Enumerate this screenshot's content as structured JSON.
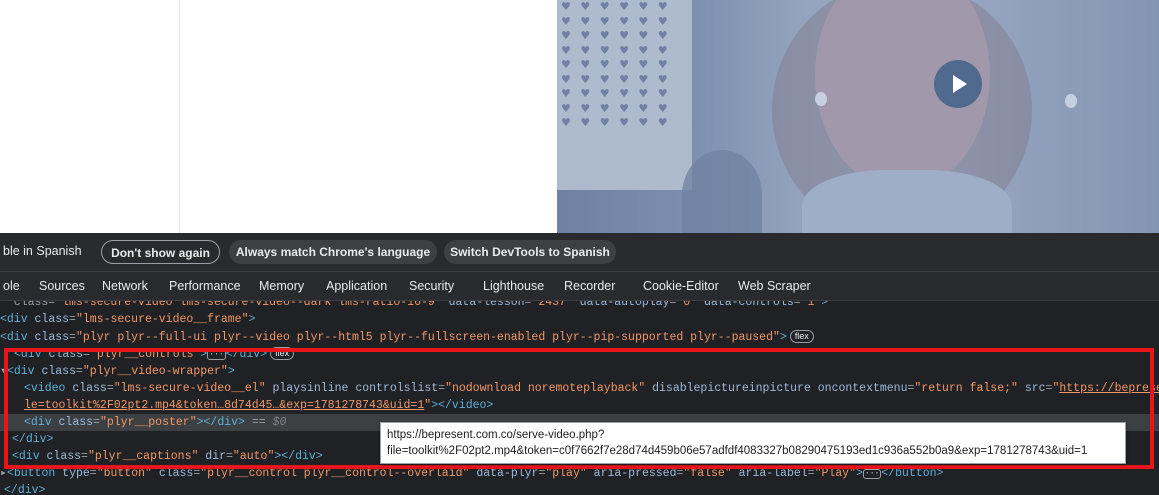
{
  "infobar": {
    "text": "ble in Spanish",
    "dont_show_again": "Don't show again",
    "always_match": "Always match Chrome's language",
    "switch_spanish": "Switch DevTools to Spanish"
  },
  "tabs": [
    "ole",
    "Sources",
    "Network",
    "Performance",
    "Memory",
    "Application",
    "Security",
    "Lighthouse",
    "Recorder",
    "Cookie-Editor",
    "Web Scraper"
  ],
  "code": {
    "l1": {
      "pre": "\" class=\"",
      "val1": "lms-secure-video lms-secure-video--dark lms-ratio-16-9",
      "a2": "data-lesson",
      "val2": "2437",
      "a3": "data-autoplay",
      "val3": "0",
      "a4": "data-controls",
      "val4": "1"
    },
    "l2": {
      "tag": "div",
      "attr": "class",
      "val": "lms-secure-video__frame"
    },
    "l3": {
      "tag": "div",
      "attr": "class",
      "val": "plyr plyr--full-ui plyr--video plyr--html5 plyr--fullscreen-enabled plyr--pip-supported plyr--paused",
      "badge": "flex"
    },
    "l4": {
      "tag": "div",
      "attr": "class",
      "val": "plyr__controls",
      "ellipsis": "···",
      "badge": "flex"
    },
    "l5": {
      "tag": "div",
      "attr": "class",
      "val": "plyr__video-wrapper"
    },
    "l6": {
      "tag": "video",
      "attr": "class",
      "val": "lms-secure-video__el",
      "a2": "playsinline",
      "a3": "controlslist",
      "v3": "nodownload noremoteplayback",
      "a4": "disablepictureinpicture",
      "a5": "oncontextmenu",
      "v5": "return false;",
      "a6": "src",
      "v6": "https://bepresent.com"
    },
    "l7": {
      "link": "le=toolkit%2F02pt2.mp4&token…8d74d45…&exp=1781278743&uid=1",
      "close": "video"
    },
    "l8": {
      "tag": "div",
      "attr": "class",
      "val": "plyr__poster",
      "close": "div",
      "eq": " == ",
      "ref": "$0"
    },
    "l9": {
      "close": "div"
    },
    "l10": {
      "tag": "div",
      "attr": "class",
      "val": "plyr__captions",
      "a2": "dir",
      "v2": "auto",
      "close": "div"
    },
    "l11": {
      "tag": "button",
      "attr": "type",
      "val": "button",
      "a2": "class",
      "v2": "plyr__control plyr__control--overlaid",
      "a3": "data-plyr",
      "v3": "play",
      "a4": "aria-pressed",
      "v4": "false",
      "a5": "aria-label",
      "v5": "Play",
      "ellipsis": "···",
      "close": "button"
    },
    "l12": {
      "close": "div"
    }
  },
  "tooltip": {
    "line1": "https://bepresent.com.co/serve-video.php?",
    "line2": "file=toolkit%2F02pt2.mp4&token=c0f7662f7e28d74d459b06e57adfdf4083327b08290475193ed1c936a552b0a9&exp=1781278743&uid=1"
  },
  "colors": {
    "highlight": "#e8151b",
    "devtools_bg": "#202124",
    "tag": "#5db0d7",
    "attr_value": "#f29766"
  },
  "icons": {
    "play": "play-icon"
  }
}
